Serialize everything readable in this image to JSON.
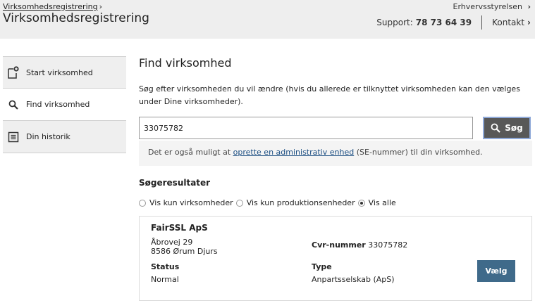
{
  "header": {
    "breadcrumb": "Virksomhedsregistrering",
    "breadcrumb_arrow": "›",
    "title": "Virksomhedsregistrering",
    "org": "Erhvervsstyrelsen",
    "org_arrow": "›",
    "support_label": "Support:",
    "support_phone": "78 73 64 39",
    "contact": "Kontakt",
    "contact_arrow": "›"
  },
  "sidebar": {
    "items": [
      {
        "label": "Start virksomhed",
        "icon": "new-document-icon"
      },
      {
        "label": "Find virksomhed",
        "icon": "search-icon"
      },
      {
        "label": "Din historik",
        "icon": "list-document-icon"
      }
    ]
  },
  "main": {
    "title": "Find virksomhed",
    "description": "Søg efter virksomheden du vil ændre (hvis du allerede er tilknyttet virksomheden kan den vælges under Dine virksomheder).",
    "search_value": "33075782",
    "search_button": "Søg",
    "info_prefix": "Det er også muligt at ",
    "info_link": "oprette en administrativ enhed",
    "info_suffix": " (SE-nummer) til din virksomhed."
  },
  "results": {
    "title": "Søgeresultater",
    "filters": [
      {
        "label": "Vis kun virksomheder",
        "checked": false
      },
      {
        "label": "Vis kun produktionsenheder",
        "checked": false
      },
      {
        "label": "Vis alle",
        "checked": true
      }
    ],
    "company": {
      "name": "FairSSL ApS",
      "address_line1": "Åbrovej 29",
      "address_line2": "8586 Ørum Djurs",
      "cvr_label": "Cvr-nummer",
      "cvr_value": "33075782",
      "status_label": "Status",
      "status_value": "Normal",
      "type_label": "Type",
      "type_value": "Anpartsselskab (ApS)",
      "choose_button": "Vælg"
    }
  },
  "colors": {
    "header_bg": "#eeeeee",
    "search_button_bg": "#585858",
    "choose_button_bg": "#3f6a8a",
    "link": "#1a4d82"
  }
}
